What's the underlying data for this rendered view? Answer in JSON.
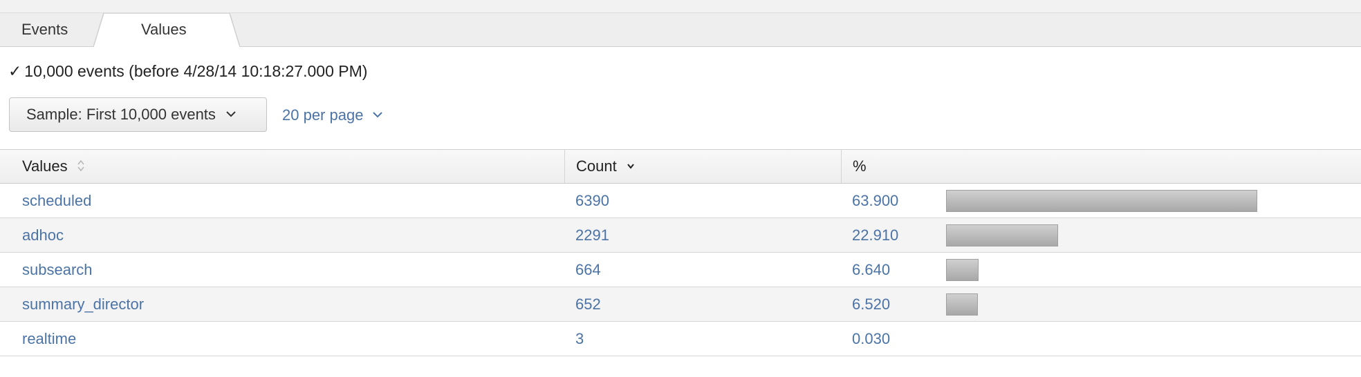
{
  "tabs": {
    "events_label": "Events",
    "values_label": "Values",
    "active": "values"
  },
  "status": {
    "check_glyph": "✓",
    "text": "10,000 events (before 4/28/14 10:18:27.000 PM)"
  },
  "controls": {
    "sample_label": "Sample: First 10,000 events",
    "per_page_label": "20 per page"
  },
  "table": {
    "headers": {
      "values": "Values",
      "count": "Count",
      "percent": "%"
    },
    "sort": {
      "column": "count",
      "direction": "desc"
    },
    "rows": [
      {
        "value": "scheduled",
        "count": "6390",
        "percent": "63.900",
        "fraction": 0.639
      },
      {
        "value": "adhoc",
        "count": "2291",
        "percent": "22.910",
        "fraction": 0.2291
      },
      {
        "value": "subsearch",
        "count": "664",
        "percent": "6.640",
        "fraction": 0.0664
      },
      {
        "value": "summary_director",
        "count": "652",
        "percent": "6.520",
        "fraction": 0.0652
      },
      {
        "value": "realtime",
        "count": "3",
        "percent": "0.030",
        "fraction": 0.0003
      }
    ]
  },
  "colors": {
    "link": "#4b73a6",
    "bar": "#b4b4b4",
    "tab_strip": "#eeeeee"
  },
  "icons": {
    "status": "checkmark-icon",
    "dropdown": "chevron-down-icon",
    "sort_neutral": "sort-neutral-icon",
    "sort_desc": "sort-desc-icon"
  }
}
